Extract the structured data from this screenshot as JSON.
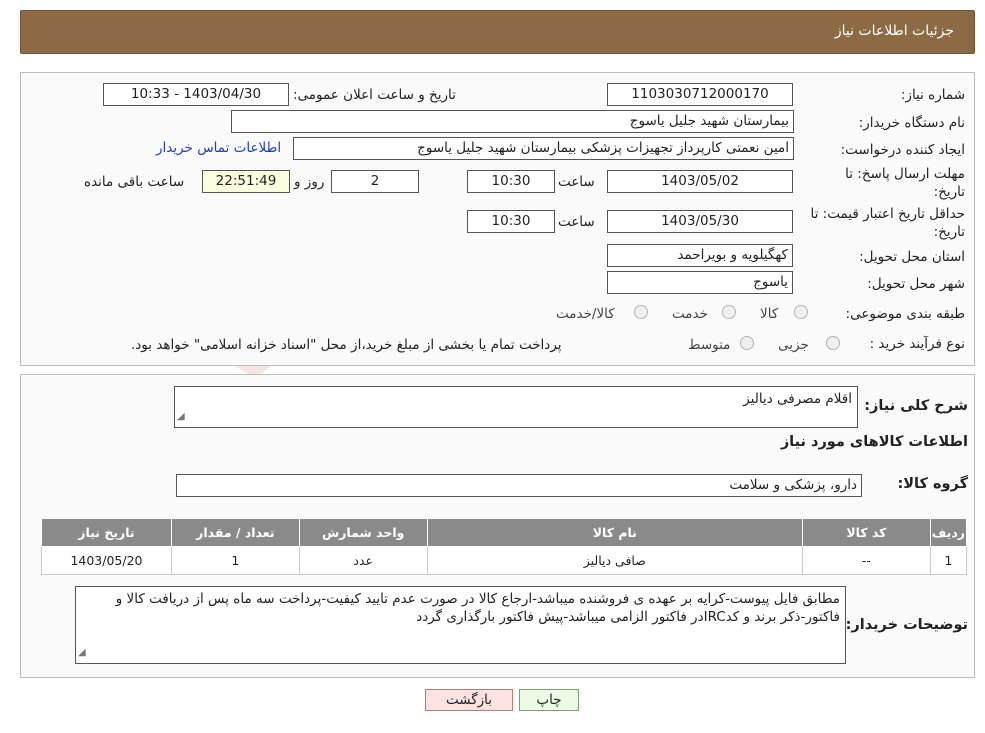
{
  "header": {
    "title": "جزئیات اطلاعات نیاز"
  },
  "details": {
    "need_number_label": "شماره نیاز:",
    "need_number": "1103030712000170",
    "announce_label": "تاریخ و ساعت اعلان عمومی:",
    "announce_value": "1403/04/30 - 10:33",
    "buyer_org_label": "نام دستگاه خریدار:",
    "buyer_org": "بیمارستان شهید جلیل یاسوج",
    "creator_label": "ایجاد کننده درخواست:",
    "creator": "امین نعمتی کارپرداز تجهیزات پزشکی بیمارستان شهید جلیل یاسوج",
    "contact_link": "اطلاعات تماس خریدار",
    "reply_deadline_label_1": "مهلت ارسال پاسخ: تا",
    "reply_deadline_label_2": "تاریخ:",
    "reply_date": "1403/05/02",
    "time_label": "ساعت",
    "reply_time": "10:30",
    "days_value": "2",
    "days_label": "روز و",
    "remaining_value": "22:51:49",
    "remaining_label": "ساعت باقی مانده",
    "validity_label_1": "حداقل تاریخ اعتبار قیمت: تا",
    "validity_label_2": "تاریخ:",
    "validity_date": "1403/05/30",
    "validity_time": "10:30",
    "province_label": "استان محل تحویل:",
    "province": "کهگیلویه و بویراحمد",
    "city_label": "شهر محل تحویل:",
    "city": "یاسوج",
    "category_label": "طبقه بندی موضوعی:",
    "category_options": [
      "کالا",
      "خدمت",
      "کالا/خدمت"
    ],
    "process_label": "نوع فرآیند خرید :",
    "process_options": [
      "جزیی",
      "متوسط"
    ],
    "process_note": "پرداخت تمام یا بخشی از مبلغ خرید،از محل \"اسناد خزانه اسلامی\" خواهد بود."
  },
  "description": {
    "label": "شرح کلی نیاز:",
    "value": "اقلام مصرفی دیالیز"
  },
  "goods": {
    "section_title": "اطلاعات کالاهای مورد نیاز",
    "group_label": "گروه کالا:",
    "group_value": "دارو، پزشکی و سلامت",
    "columns": [
      "ردیف",
      "کد کالا",
      "نام کالا",
      "واحد شمارش",
      "تعداد / مقدار",
      "تاریخ نیاز"
    ],
    "rows": [
      [
        "1",
        "--",
        "صافی دیالیز",
        "عدد",
        "1",
        "1403/05/20"
      ]
    ]
  },
  "buyer_notes": {
    "label": "توضیحات خریدار:",
    "value": "مطابق فایل پیوست-کرایه بر عهده ی فروشنده میباشد-ارجاع کالا در صورت عدم تایید کیفیت-پرداخت سه ماه پس از دریافت کالا و فاکتور-ذکر برند و کدIRCدر فاکتور الزامی میباشد-پیش فاکتور بارگذاری گردد"
  },
  "buttons": {
    "print": "چاپ",
    "back": "بازگشت"
  },
  "watermark": {
    "text": "AriaTender.neT"
  }
}
